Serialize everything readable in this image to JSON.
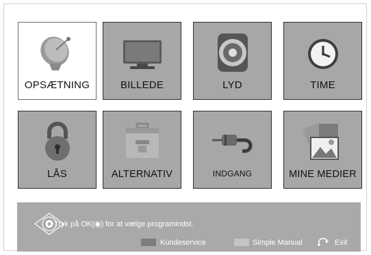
{
  "menu": {
    "tiles": [
      {
        "label": "OPSÆTNING",
        "icon": "satellite-dish-icon",
        "selected": true
      },
      {
        "label": "BILLEDE",
        "icon": "monitor-icon",
        "selected": false
      },
      {
        "label": "LYD",
        "icon": "speaker-icon",
        "selected": false
      },
      {
        "label": "TIME",
        "icon": "clock-icon",
        "selected": false
      },
      {
        "label": "LÅS",
        "icon": "padlock-icon",
        "selected": false
      },
      {
        "label": "ALTERNATIV",
        "icon": "toolbox-icon",
        "selected": false
      },
      {
        "label": "INDGANG",
        "icon": "input-cable-icon",
        "selected": false
      },
      {
        "label": "MINE MEDIER",
        "icon": "media-photos-icon",
        "selected": false
      }
    ]
  },
  "footer": {
    "help_text": "Tryk på OK(◉) for at vælge programindst.",
    "legend": {
      "customer_service": "Kundeservice",
      "simple_manual": "Simple Manual",
      "exit": "Exit"
    },
    "colors": {
      "customer_service": "#7d7d7d",
      "simple_manual": "#c4c4c4"
    }
  }
}
